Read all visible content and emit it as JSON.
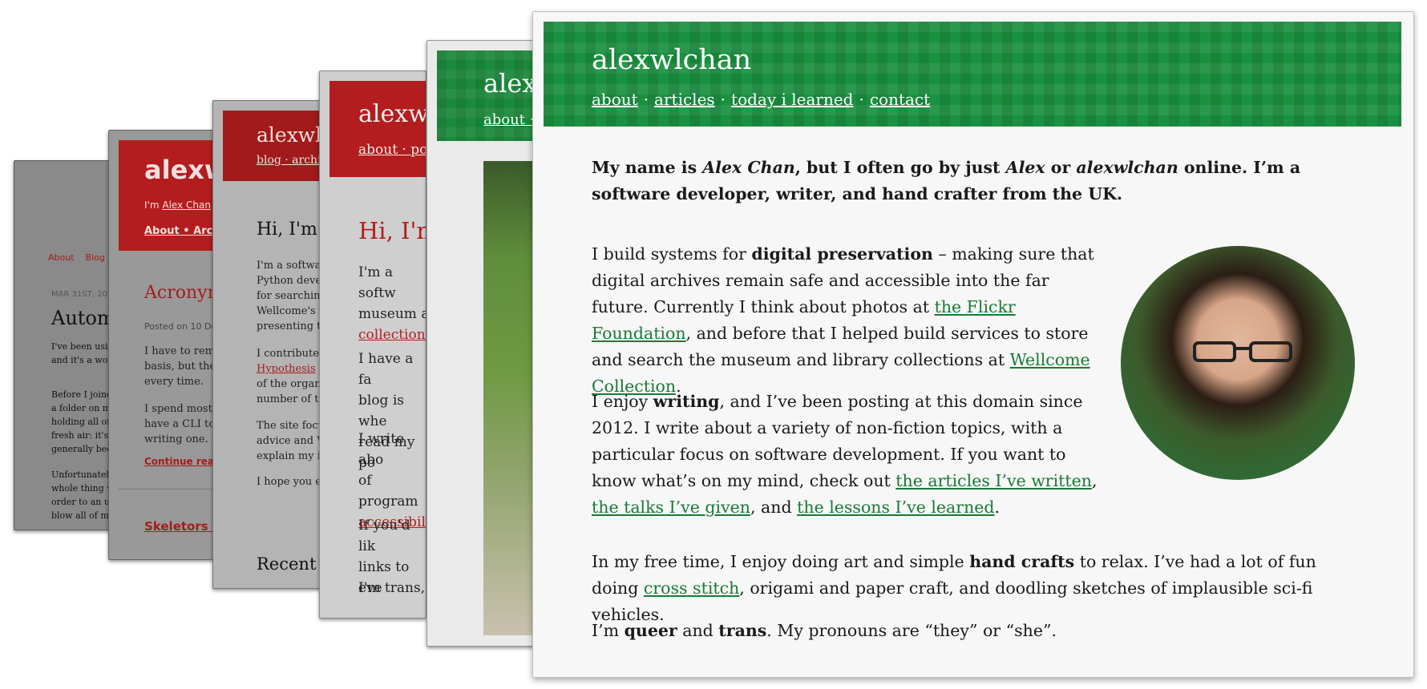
{
  "card1": {
    "nav": [
      "About",
      "Blog"
    ],
    "date": "MAR 31ST, 201",
    "title": "Autom",
    "p1": [
      "I've been usin",
      "and it's a wonc"
    ],
    "p2": [
      "Before I joine",
      "a folder on my",
      "holding all of",
      "fresh air: it's f",
      "generally been"
    ],
    "p3": [
      "Unfortunately",
      "whole thing w",
      "order to an un",
      "blow all of my"
    ]
  },
  "card2": {
    "brand": "alexw",
    "im_prefix": "I'm",
    "im_link": "Alex Chan",
    "links": "About • Archi",
    "heading": "Acronym",
    "posted": "Posted on 10 De",
    "p1": [
      "I have to reme",
      "basis, but ther",
      "every time."
    ],
    "p2": [
      "I spend most o",
      "have a CLI too",
      "writing one."
    ],
    "continue": "Continue reac",
    "heading2": "Skeletors A"
  },
  "card3": {
    "brand": "alexwlc",
    "links": "blog · archiv",
    "heading": "Hi, I'm A",
    "p1": [
      "I'm a softwa",
      "Python deve",
      "for searchin",
      "Wellcome's",
      "presenting t"
    ],
    "p2_lines": [
      "I contribute",
      "Hypothesis",
      "of the organ",
      "number of ta"
    ],
    "p3": [
      "The site focu",
      "advice and V",
      "explain my i"
    ],
    "p4": "I hope you e",
    "heading2": "Recent p"
  },
  "card4": {
    "brand": "alexwl",
    "links": "about · pos",
    "heading": "Hi, I'm",
    "p1": [
      "I'm a softw",
      "museum a",
      "collections"
    ],
    "p2": [
      "I have a fa",
      "blog is whe",
      "read my po"
    ],
    "p3": [
      "I write abo",
      "of program",
      "accessibili"
    ],
    "p4": [
      "If you'd lik",
      "links to eve"
    ],
    "p5": "I'm trans,"
  },
  "card5": {
    "brand": "alex",
    "links": "about ·"
  },
  "main": {
    "brand": "alexwlchan",
    "nav": [
      "about",
      "articles",
      "today i learned",
      "contact"
    ],
    "intro": {
      "t1": "My name is ",
      "name": "Alex Chan",
      "t2": ", but I often go by just ",
      "alex": "Alex",
      "t3": " or ",
      "handle": "alexwlchan",
      "t4": " online. I’m a software developer, writer, and hand crafter from the UK."
    },
    "para2": {
      "t1": "I build systems for ",
      "bold": "digital preservation",
      "t2": " – making sure that digital archives remain safe and accessible into the far future. Currently I think about photos at ",
      "link1": "the Flickr Foundation",
      "t3": ", and before that I helped build services to store and search the museum and library collections at ",
      "link2": "Wellcome Collection",
      "t4": "."
    },
    "para3": {
      "t1": "I enjoy ",
      "bold": "writing",
      "t2": ", and I’ve been posting at this domain since 2012. I write about a variety of non-fiction topics, with a particular focus on software development. If you want to know what’s on my mind, check out ",
      "link1": "the articles I’ve written",
      "t3": ", ",
      "link2": "the talks I’ve given",
      "t4": ", and ",
      "link3": "the lessons I’ve learned",
      "t5": "."
    },
    "para4": {
      "t1": "In my free time, I enjoy doing art and simple ",
      "bold": "hand crafts",
      "t2": " to relax. I’ve had a lot of fun doing ",
      "link1": "cross stitch",
      "t3": ", origami and paper craft, and doodling sketches of implausible sci-fi vehicles."
    },
    "para5": {
      "t1": "I’m ",
      "b1": "queer",
      "t2": " and ",
      "b2": "trans",
      "t3": ". My pronouns are “they” or “she”."
    },
    "colors": {
      "green": "#1a9140",
      "link_green": "#1a7a36",
      "red": "#b31d1d"
    }
  }
}
